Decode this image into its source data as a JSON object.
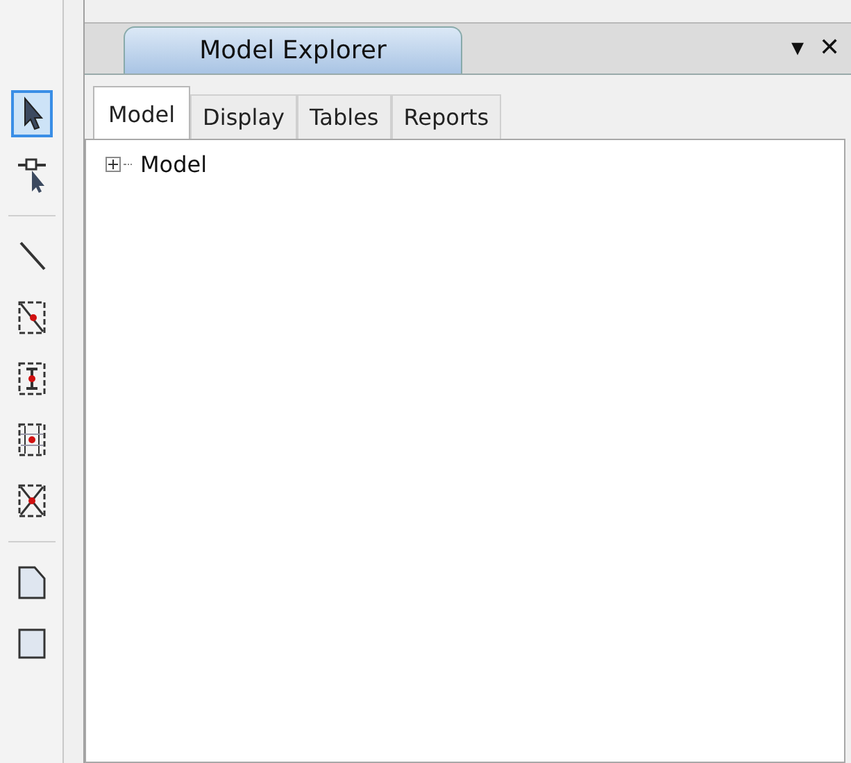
{
  "toolbar": {
    "tools": [
      {
        "kind": "pointer",
        "selected": true
      },
      {
        "kind": "node-pointer",
        "selected": false
      },
      {
        "kind": "line",
        "selected": false
      },
      {
        "kind": "diagonal-frame",
        "selected": false
      },
      {
        "kind": "ibeam-frame",
        "selected": false
      },
      {
        "kind": "grid-frame",
        "selected": false
      },
      {
        "kind": "cross-frame",
        "selected": false
      },
      {
        "kind": "cut-corner",
        "selected": false
      },
      {
        "kind": "square",
        "selected": false
      }
    ]
  },
  "panel": {
    "title": "Model Explorer",
    "menu_glyph": "▾",
    "close_glyph": "✕"
  },
  "tabs": [
    {
      "label": "Model",
      "selected": true
    },
    {
      "label": "Display",
      "selected": false
    },
    {
      "label": "Tables",
      "selected": false
    },
    {
      "label": "Reports",
      "selected": false
    }
  ],
  "tree": [
    {
      "label": "Model",
      "expanded": false
    }
  ]
}
